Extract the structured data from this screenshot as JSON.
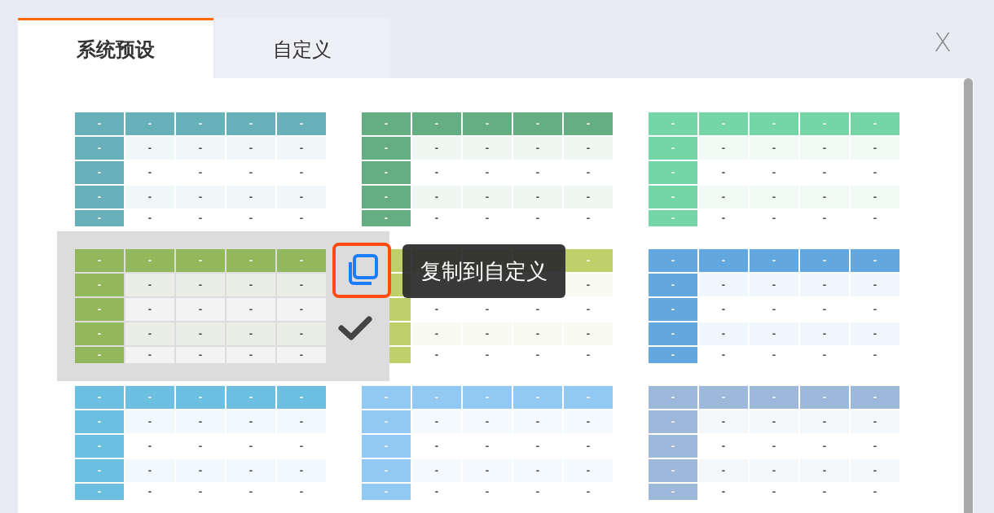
{
  "tabs": [
    {
      "label": "系统预设",
      "selected": true
    },
    {
      "label": "自定义",
      "selected": false
    }
  ],
  "close_label": "X",
  "presets": [
    {
      "color": "#67afb9",
      "hovered": false,
      "rows": [
        [
          "-",
          "-",
          "-",
          "-",
          "-"
        ],
        [
          "-",
          "-",
          "-",
          "-",
          "-"
        ],
        [
          "-",
          "-",
          "-",
          "-",
          "-"
        ],
        [
          "-",
          "-",
          "-",
          "-",
          "-"
        ],
        [
          "-",
          "-",
          "-",
          "-",
          "-"
        ]
      ]
    },
    {
      "color": "#65ad82",
      "hovered": false,
      "rows": [
        [
          "-",
          "-",
          "-",
          "-",
          "-"
        ],
        [
          "-",
          "-",
          "-",
          "-",
          "-"
        ],
        [
          "-",
          "-",
          "-",
          "-",
          "-"
        ],
        [
          "-",
          "-",
          "-",
          "-",
          "-"
        ],
        [
          "-",
          "-",
          "-",
          "-",
          "-"
        ]
      ]
    },
    {
      "color": "#74d5a6",
      "hovered": false,
      "rows": [
        [
          "-",
          "-",
          "-",
          "-",
          "-"
        ],
        [
          "-",
          "-",
          "-",
          "-",
          "-"
        ],
        [
          "-",
          "-",
          "-",
          "-",
          "-"
        ],
        [
          "-",
          "-",
          "-",
          "-",
          "-"
        ],
        [
          "-",
          "-",
          "-",
          "-",
          "-"
        ]
      ]
    },
    {
      "color": "#93b85b",
      "hovered": true,
      "rows": [
        [
          "-",
          "-",
          "-",
          "-",
          "-"
        ],
        [
          "-",
          "-",
          "-",
          "-",
          "-"
        ],
        [
          "-",
          "-",
          "-",
          "-",
          "-"
        ],
        [
          "-",
          "-",
          "-",
          "-",
          "-"
        ],
        [
          "-",
          "-",
          "-",
          "-",
          "-"
        ]
      ]
    },
    {
      "color": "#bfd06a",
      "hovered": false,
      "rows": [
        [
          null,
          null,
          null,
          null,
          "-"
        ],
        [
          null,
          null,
          null,
          null,
          "-"
        ],
        [
          null,
          "-",
          "-",
          "-",
          "-"
        ],
        [
          null,
          "-",
          "-",
          "-",
          "-"
        ],
        [
          null,
          "-",
          "-",
          "-",
          "-"
        ]
      ]
    },
    {
      "color": "#62a7de",
      "hovered": false,
      "rows": [
        [
          "-",
          "-",
          "-",
          "-",
          "-"
        ],
        [
          "-",
          "-",
          "-",
          "-",
          "-"
        ],
        [
          "-",
          "-",
          "-",
          "-",
          "-"
        ],
        [
          "-",
          "-",
          "-",
          "-",
          "-"
        ],
        [
          "-",
          "-",
          "-",
          "-",
          "-"
        ]
      ]
    },
    {
      "color": "#6bbfe0",
      "hovered": false,
      "rows": [
        [
          "-",
          "-",
          "-",
          "-",
          "-"
        ],
        [
          "-",
          "-",
          "-",
          "-",
          "-"
        ],
        [
          "-",
          "-",
          "-",
          "-",
          "-"
        ],
        [
          "-",
          "-",
          "-",
          "-",
          "-"
        ],
        [
          "-",
          "-",
          "-",
          "-",
          "-"
        ]
      ]
    },
    {
      "color": "#92c9f2",
      "hovered": false,
      "rows": [
        [
          "-",
          "-",
          "-",
          "-",
          "-"
        ],
        [
          "-",
          "-",
          "-",
          "-",
          "-"
        ],
        [
          "-",
          "-",
          "-",
          "-",
          "-"
        ],
        [
          "-",
          "-",
          "-",
          "-",
          "-"
        ],
        [
          "-",
          "-",
          "-",
          "-",
          "-"
        ]
      ]
    },
    {
      "color": "#9db8da",
      "hovered": false,
      "rows": [
        [
          "-",
          "-",
          "-",
          "-",
          "-"
        ],
        [
          "-",
          "-",
          "-",
          "-",
          "-"
        ],
        [
          "-",
          "-",
          "-",
          "-",
          "-"
        ],
        [
          "-",
          "-",
          "-",
          "-",
          "-"
        ],
        [
          "-",
          "-",
          "-",
          "-",
          "-"
        ]
      ]
    }
  ],
  "copy_tooltip": "复制到自定义"
}
